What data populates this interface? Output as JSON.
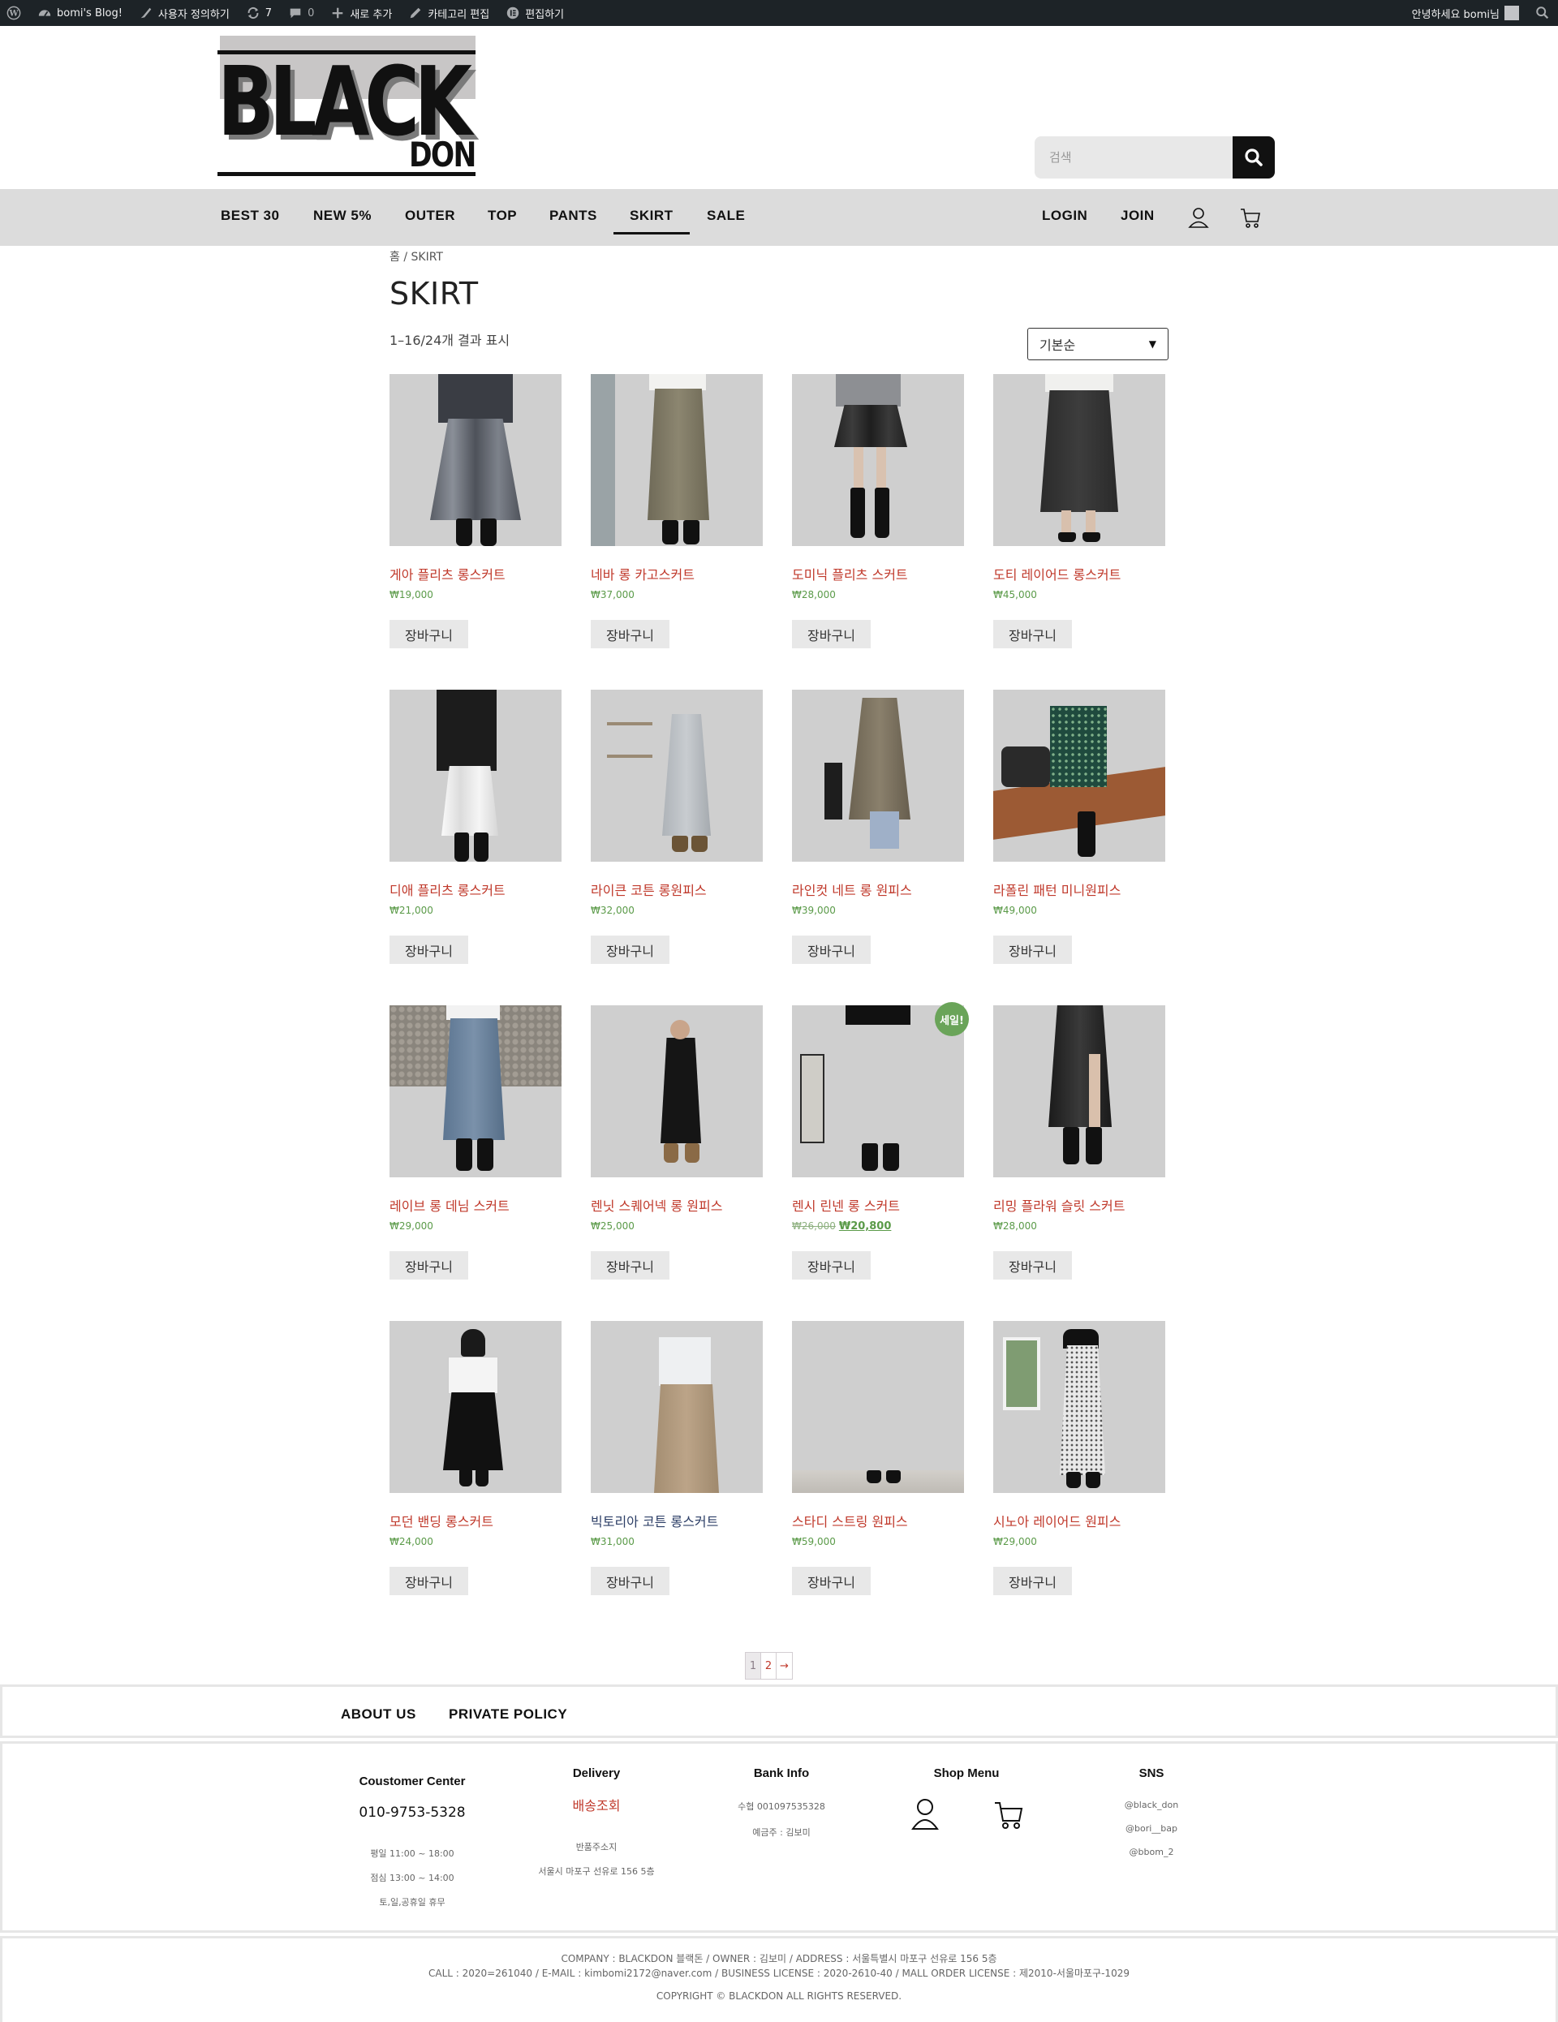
{
  "admin_bar": {
    "site_name": "bomi's Blog!",
    "customize": "사용자 정의하기",
    "updates_count": "7",
    "comments_count": "0",
    "new": "새로 추가",
    "edit_category": "카테고리 편집",
    "edit_site": "편집하기",
    "greeting": "안녕하세요 bomi님"
  },
  "header": {
    "logo_word1": "BLACK",
    "logo_word2": "DON",
    "search_placeholder": "검색"
  },
  "nav": {
    "items": [
      "BEST 30",
      "NEW 5%",
      "OUTER",
      "TOP",
      "PANTS",
      "SKIRT",
      "SALE"
    ],
    "active": "SKIRT",
    "login": "LOGIN",
    "join": "JOIN"
  },
  "shop": {
    "breadcrumb": "홈 / SKIRT",
    "title": "SKIRT",
    "result_count": "1–16/24개 결과 표시",
    "orderby": "기본순",
    "add_to_cart": "장바구니",
    "sale_badge": "세일!"
  },
  "products": [
    {
      "name": "게아 플리츠 롱스커트",
      "price": "₩19,000"
    },
    {
      "name": "네바 롱 카고스커트",
      "price": "₩37,000"
    },
    {
      "name": "도미닉 플리츠 스커트",
      "price": "₩28,000"
    },
    {
      "name": "도티 레이어드 롱스커트",
      "price": "₩45,000"
    },
    {
      "name": "디애 플리츠 롱스커트",
      "price": "₩21,000"
    },
    {
      "name": "라이큰 코튼 롱원피스",
      "price": "₩32,000"
    },
    {
      "name": "라인컷 네트 롱 원피스",
      "price": "₩39,000"
    },
    {
      "name": "라폴린 패턴 미니원피스",
      "price": "₩49,000"
    },
    {
      "name": "레이브 롱 데님 스커트",
      "price": "₩29,000"
    },
    {
      "name": "렌닛 스퀘어넥 롱 원피스",
      "price": "₩25,000"
    },
    {
      "name": "렌시 린넨 롱 스커트",
      "price_old": "₩26,000",
      "price": "₩20,800"
    },
    {
      "name": "리밍 플라워 슬릿 스커트",
      "price": "₩28,000"
    },
    {
      "name": "모던 밴딩 롱스커트",
      "price": "₩24,000"
    },
    {
      "name": "빅토리아 코튼 롱스커트",
      "price": "₩31,000"
    },
    {
      "name": "스타디 스트링 원피스",
      "price": "₩59,000"
    },
    {
      "name": "시노아 레이어드 원피스",
      "price": "₩29,000"
    }
  ],
  "pagination": {
    "page1": "1",
    "page2": "2",
    "next": "→"
  },
  "footer": {
    "about": "ABOUT US",
    "privacy": "PRIVATE POLICY",
    "cs_title": "Coustomer Center",
    "cs_phone": "010-9753-5328",
    "cs_hours1": "평일 11:00 ~ 18:00",
    "cs_hours2": "점심 13:00 ~ 14:00",
    "cs_hours3": "토,일,공휴일 휴무",
    "delivery_title": "Delivery",
    "delivery_link": "배송조회",
    "return_label": "반품주소지",
    "return_addr": "서울시 마포구 선유로 156 5층",
    "bank_title": "Bank Info",
    "bank_account": "수협  001097535328",
    "bank_holder": "예금주 : 김보미",
    "shop_menu_title": "Shop Menu",
    "sns_title": "SNS",
    "sns1": "@black_don",
    "sns2": "@bori__bap",
    "sns3": "@bbom_2",
    "company_line1": "COMPANY : BLACKDON 블랙돈 / OWNER : 김보미 / ADDRESS :  서울특별시 마포구 선유로 156 5층",
    "company_line2": "CALL : 2020=261040 / E-MAIL : kimbomi2172@naver.com / BUSINESS LICENSE : 2020-2610-40 / MALL ORDER LICENSE : 제2010-서울마포구-1029",
    "copyright": "COPYRIGHT © BLACKDON ALL RIGHTS RESERVED."
  }
}
